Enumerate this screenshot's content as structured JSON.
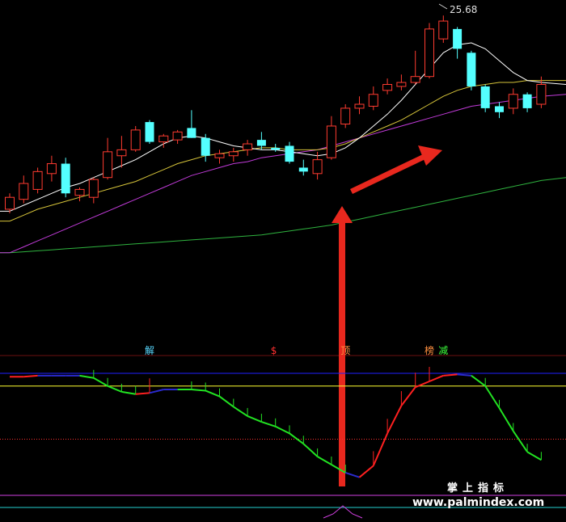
{
  "colors": {
    "background": "#000000",
    "up_candle": "#ff3b30",
    "down_candle": "#54ffff",
    "ma_fast": "#ffffff",
    "ma_mid": "#d6c43a",
    "ma_slow": "#c13bd9",
    "ma_long": "#2fb33f",
    "osc_rising": "#ff2020",
    "osc_falling": "#22e322",
    "osc_flat": "#2a2acc",
    "ref_blue": "#2020ff",
    "ref_yellow": "#ffff30",
    "ref_red_dotted": "#ff3030",
    "ref_magenta": "#d040e0",
    "arrow": "#e8281e",
    "signal_cyan": "#58d8ff",
    "signal_red": "#ff3030",
    "signal_orange": "#ff9040",
    "signal_green": "#3cff3c"
  },
  "price_label": "25.68",
  "signal_markers": [
    {
      "text": "解",
      "color": "#58d8ff",
      "x_index": 10
    },
    {
      "text": "$",
      "color": "#ff3030",
      "x_index": 19
    },
    {
      "text": "顶",
      "color": "#ff9040",
      "x_index": 24
    },
    {
      "text": "榜",
      "color": "#ff9040",
      "x_index": 30
    },
    {
      "text": "减",
      "color": "#3cff3c",
      "x_index": 31
    }
  ],
  "watermark": {
    "cn": "掌上指标",
    "url": "www.palmindex.com"
  },
  "chart_data": {
    "type": "candlestick",
    "title": "",
    "xlabel": "",
    "ylabel": "",
    "candles": [
      {
        "o": 15.9,
        "h": 16.7,
        "l": 15.7,
        "c": 16.5
      },
      {
        "o": 16.4,
        "h": 17.6,
        "l": 16.2,
        "c": 17.2
      },
      {
        "o": 16.9,
        "h": 18.0,
        "l": 16.7,
        "c": 17.8
      },
      {
        "o": 17.7,
        "h": 18.6,
        "l": 17.3,
        "c": 18.2
      },
      {
        "o": 18.2,
        "h": 18.5,
        "l": 16.5,
        "c": 16.7
      },
      {
        "o": 16.6,
        "h": 17.0,
        "l": 16.3,
        "c": 16.9
      },
      {
        "o": 16.5,
        "h": 17.5,
        "l": 16.2,
        "c": 17.4
      },
      {
        "o": 17.5,
        "h": 19.5,
        "l": 17.4,
        "c": 18.8
      },
      {
        "o": 18.6,
        "h": 19.6,
        "l": 18.0,
        "c": 18.9
      },
      {
        "o": 18.9,
        "h": 20.1,
        "l": 18.8,
        "c": 19.9
      },
      {
        "o": 20.3,
        "h": 20.4,
        "l": 19.2,
        "c": 19.3
      },
      {
        "o": 19.3,
        "h": 19.7,
        "l": 19.0,
        "c": 19.6
      },
      {
        "o": 19.4,
        "h": 19.9,
        "l": 19.2,
        "c": 19.8
      },
      {
        "o": 20.0,
        "h": 20.9,
        "l": 19.5,
        "c": 19.5
      },
      {
        "o": 19.5,
        "h": 19.7,
        "l": 18.3,
        "c": 18.6
      },
      {
        "o": 18.5,
        "h": 18.9,
        "l": 18.2,
        "c": 18.7
      },
      {
        "o": 18.6,
        "h": 19.0,
        "l": 18.3,
        "c": 18.8
      },
      {
        "o": 18.9,
        "h": 19.4,
        "l": 18.6,
        "c": 19.2
      },
      {
        "o": 19.4,
        "h": 19.8,
        "l": 18.9,
        "c": 19.1
      },
      {
        "o": 19.0,
        "h": 19.2,
        "l": 18.8,
        "c": 18.9
      },
      {
        "o": 19.1,
        "h": 19.3,
        "l": 18.2,
        "c": 18.3
      },
      {
        "o": 18.0,
        "h": 18.4,
        "l": 17.6,
        "c": 17.8
      },
      {
        "o": 17.7,
        "h": 18.8,
        "l": 17.4,
        "c": 18.4
      },
      {
        "o": 18.5,
        "h": 20.6,
        "l": 18.4,
        "c": 20.1
      },
      {
        "o": 20.2,
        "h": 21.2,
        "l": 20.0,
        "c": 21.0
      },
      {
        "o": 21.0,
        "h": 21.6,
        "l": 20.7,
        "c": 21.2
      },
      {
        "o": 21.1,
        "h": 22.1,
        "l": 20.9,
        "c": 21.7
      },
      {
        "o": 21.9,
        "h": 22.5,
        "l": 21.7,
        "c": 22.2
      },
      {
        "o": 22.1,
        "h": 22.7,
        "l": 21.9,
        "c": 22.3
      },
      {
        "o": 22.3,
        "h": 23.9,
        "l": 22.2,
        "c": 22.6
      },
      {
        "o": 22.6,
        "h": 25.3,
        "l": 22.5,
        "c": 25.0
      },
      {
        "o": 24.5,
        "h": 25.68,
        "l": 24.3,
        "c": 25.4
      },
      {
        "o": 25.0,
        "h": 25.1,
        "l": 23.5,
        "c": 24.0
      },
      {
        "o": 23.8,
        "h": 23.9,
        "l": 21.9,
        "c": 22.1
      },
      {
        "o": 22.1,
        "h": 22.2,
        "l": 20.8,
        "c": 21.0
      },
      {
        "o": 21.1,
        "h": 21.3,
        "l": 20.5,
        "c": 20.8
      },
      {
        "o": 21.0,
        "h": 22.0,
        "l": 20.7,
        "c": 21.7
      },
      {
        "o": 21.7,
        "h": 21.8,
        "l": 20.8,
        "c": 21.0
      },
      {
        "o": 21.2,
        "h": 22.6,
        "l": 21.0,
        "c": 22.2
      }
    ],
    "price_range": [
      13.0,
      26.3
    ],
    "ma_fast": [
      15.8,
      16.1,
      16.4,
      16.7,
      17.0,
      17.2,
      17.5,
      17.8,
      18.1,
      18.4,
      18.8,
      19.2,
      19.5,
      19.6,
      19.5,
      19.3,
      19.1,
      19.0,
      18.9,
      18.9,
      18.8,
      18.7,
      18.6,
      18.7,
      19.0,
      19.5,
      20.1,
      20.7,
      21.4,
      22.2,
      23.0,
      23.8,
      24.2,
      24.3,
      24.0,
      23.4,
      22.8,
      22.4,
      22.3
    ],
    "ma_mid": [
      15.3,
      15.6,
      15.9,
      16.1,
      16.3,
      16.5,
      16.7,
      16.9,
      17.1,
      17.3,
      17.6,
      17.9,
      18.2,
      18.4,
      18.6,
      18.7,
      18.8,
      18.9,
      19.0,
      19.0,
      18.9,
      18.9,
      18.9,
      19.0,
      19.2,
      19.5,
      19.8,
      20.1,
      20.4,
      20.8,
      21.2,
      21.6,
      21.9,
      22.1,
      22.2,
      22.3,
      22.3,
      22.4,
      22.4
    ],
    "ma_slow": [
      13.7,
      14.0,
      14.3,
      14.6,
      14.9,
      15.2,
      15.5,
      15.8,
      16.1,
      16.4,
      16.7,
      17.0,
      17.3,
      17.6,
      17.8,
      18.0,
      18.2,
      18.3,
      18.5,
      18.6,
      18.7,
      18.8,
      18.9,
      19.1,
      19.3,
      19.5,
      19.7,
      19.9,
      20.1,
      20.3,
      20.5,
      20.7,
      20.9,
      21.1,
      21.2,
      21.3,
      21.4,
      21.5,
      21.6
    ],
    "ma_long": [
      13.7,
      13.75,
      13.8,
      13.85,
      13.9,
      13.95,
      14.0,
      14.05,
      14.1,
      14.15,
      14.2,
      14.25,
      14.3,
      14.35,
      14.4,
      14.45,
      14.5,
      14.55,
      14.6,
      14.7,
      14.8,
      14.9,
      15.0,
      15.1,
      15.25,
      15.4,
      15.55,
      15.7,
      15.85,
      16.0,
      16.15,
      16.3,
      16.45,
      16.6,
      16.75,
      16.9,
      17.05,
      17.2,
      17.35
    ],
    "oscillator": {
      "range": [
        0,
        100
      ],
      "ref_levels": {
        "blue": 100,
        "yellow": 89,
        "red_dotted": 43
      },
      "values": [
        97,
        97,
        98,
        98,
        98,
        98,
        96,
        89,
        84,
        82,
        83,
        86,
        86,
        86,
        85,
        80,
        71,
        63,
        58,
        54,
        48,
        39,
        28,
        21,
        14,
        10,
        20,
        48,
        72,
        88,
        93,
        98,
        99,
        98,
        89,
        70,
        50,
        32,
        25
      ],
      "state": [
        "rise",
        "rise",
        "rise",
        "flat",
        "flat",
        "flat",
        "fall",
        "fall",
        "fall",
        "fall",
        "rise",
        "flat",
        "flat",
        "fall",
        "fall",
        "fall",
        "fall",
        "fall",
        "fall",
        "fall",
        "fall",
        "fall",
        "fall",
        "fall",
        "fall",
        "flat",
        "rise",
        "rise",
        "rise",
        "rise",
        "rise",
        "rise",
        "rise",
        "flat",
        "fall",
        "fall",
        "fall",
        "fall",
        "fall"
      ]
    },
    "grid": false,
    "legend": "none"
  }
}
